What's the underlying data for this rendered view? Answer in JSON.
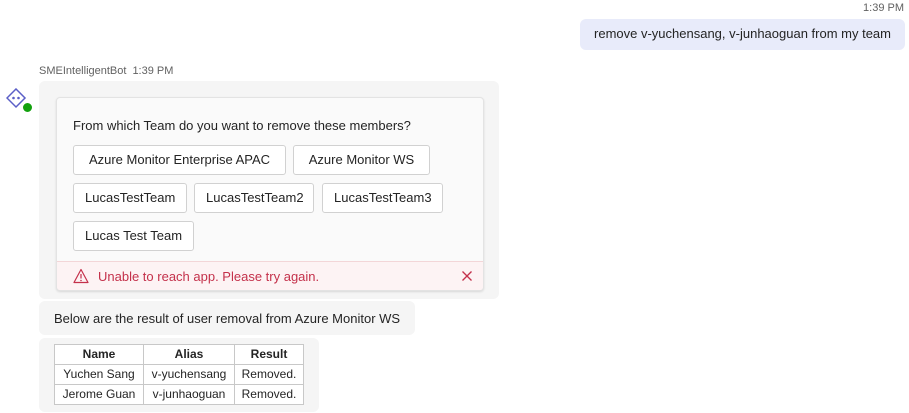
{
  "user_message": {
    "time": "1:39 PM",
    "text": "remove v-yuchensang, v-junhaoguan from my team"
  },
  "bot": {
    "name": "SMEIntelligentBot",
    "time": "1:39 PM",
    "avatar_icon": "bot-icon",
    "status_color": "#13a10e"
  },
  "card": {
    "question": "From which Team do you want to remove these members?",
    "teams": [
      "Azure Monitor Enterprise APAC",
      "Azure Monitor WS",
      "LucasTestTeam",
      "LucasTestTeam2",
      "LucasTestTeam3",
      "Lucas Test Team"
    ],
    "error": {
      "text": "Unable to reach app. Please try again.",
      "icon": "warning-icon",
      "color": "#c4314b"
    }
  },
  "result_message": "Below are the result of user removal from Azure Monitor WS",
  "result_table": {
    "headers": [
      "Name",
      "Alias",
      "Result"
    ],
    "rows": [
      [
        "Yuchen Sang",
        "v-yuchensang",
        "Removed."
      ],
      [
        "Jerome Guan",
        "v-junhaoguan",
        "Removed."
      ]
    ]
  }
}
